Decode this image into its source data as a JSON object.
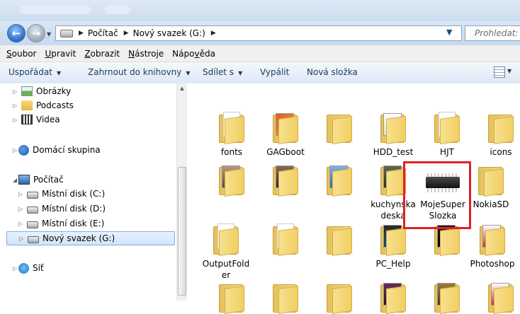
{
  "address": {
    "crumbs": [
      "Počítač",
      "Nový svazek (G:)"
    ],
    "search_placeholder": "Prohledat: N"
  },
  "menu": [
    {
      "pre": "",
      "u": "S",
      "post": "oubor"
    },
    {
      "pre": "",
      "u": "U",
      "post": "pravit"
    },
    {
      "pre": "",
      "u": "Z",
      "post": "obrazit"
    },
    {
      "pre": "",
      "u": "N",
      "post": "ástroje"
    },
    {
      "pre": "Nápo",
      "u": "v",
      "post": "ěda"
    }
  ],
  "toolbar": {
    "organize": "Uspořádat",
    "include": "Zahrnout do knihovny",
    "share": "Sdílet s",
    "burn": "Vypálit",
    "new_folder": "Nová složka"
  },
  "nav": {
    "pictures": "Obrázky",
    "podcasts": "Podcasts",
    "videos": "Videa",
    "homegroup": "Domácí skupina",
    "computer": "Počítač",
    "disk_c": "Místní disk (C:)",
    "disk_d": "Místní disk (D:)",
    "disk_e": "Místní disk (E:)",
    "disk_g": "Nový svazek (G:)",
    "network": "Síť"
  },
  "folders": {
    "fonts": "fonts",
    "gagboot": "GAGboot",
    "hdd_test": "HDD_test",
    "hjt": "HJT",
    "icons": "icons",
    "kuchynska_1": "kuchynska",
    "kuchynska_2": "deska",
    "moje_1": "MojeSuper",
    "moje_2": "Slozka",
    "nokiasd": "NokiaSD",
    "output_1": "OutputFold",
    "output_2": "er",
    "pc_help": "PC_Help",
    "photoshop": "Photoshop"
  },
  "colors": {
    "highlight": "#e0202a",
    "toolbar_text": "#1e395b",
    "selection_border": "#84acdd"
  }
}
